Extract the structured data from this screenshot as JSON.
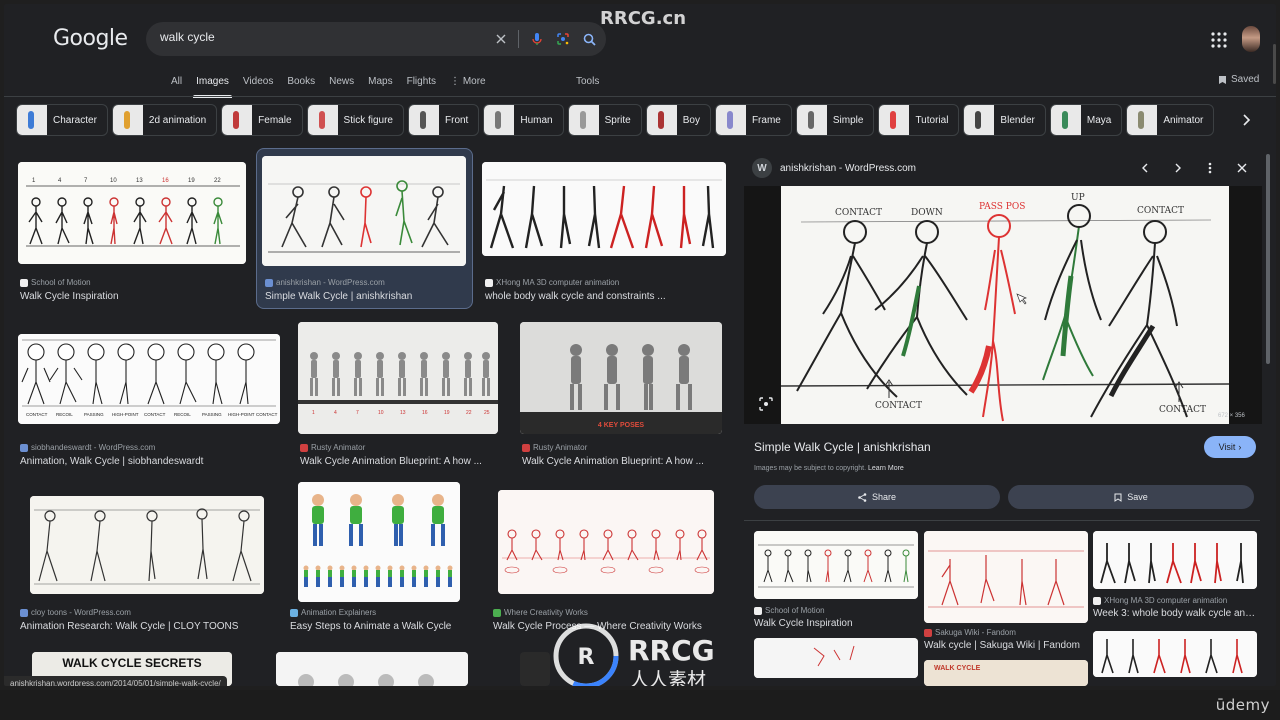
{
  "watermark": "RRCG.cn",
  "watermark_logo": {
    "line1": "RRCG",
    "line2": "人人素材"
  },
  "header": {
    "logo": "Google",
    "search_value": "walk cycle",
    "saved": "Saved"
  },
  "tabs": [
    {
      "label": "All",
      "active": false
    },
    {
      "label": "Images",
      "active": true
    },
    {
      "label": "Videos",
      "active": false
    },
    {
      "label": "Books",
      "active": false
    },
    {
      "label": "News",
      "active": false
    },
    {
      "label": "Maps",
      "active": false
    },
    {
      "label": "Flights",
      "active": false
    },
    {
      "label": "⋮ More",
      "active": false
    }
  ],
  "tools": "Tools",
  "chips": [
    {
      "label": "Character",
      "color": "#3d7bd6"
    },
    {
      "label": "2d animation",
      "color": "#e0a030"
    },
    {
      "label": "Female",
      "color": "#c03a3a"
    },
    {
      "label": "Stick figure",
      "color": "#d05050"
    },
    {
      "label": "Front",
      "color": "#555555"
    },
    {
      "label": "Human",
      "color": "#777777"
    },
    {
      "label": "Sprite",
      "color": "#999999"
    },
    {
      "label": "Boy",
      "color": "#aa3333"
    },
    {
      "label": "Frame",
      "color": "#8888cc"
    },
    {
      "label": "Simple",
      "color": "#666666"
    },
    {
      "label": "Tutorial",
      "color": "#e04040"
    },
    {
      "label": "Blender",
      "color": "#444444"
    },
    {
      "label": "Maya",
      "color": "#3a8a5a"
    },
    {
      "label": "Animator",
      "color": "#8a8a70"
    }
  ],
  "results": [
    {
      "source": "School of Motion",
      "title": "Walk Cycle Inspiration",
      "fav": "#f0f0f0"
    },
    {
      "source": "anishkrishan - WordPress.com",
      "title": "Simple Walk Cycle | anishkrishan",
      "fav": "#6b8fd1"
    },
    {
      "source": "XHong MA 3D computer animation",
      "title": "whole body walk cycle and constraints ...",
      "fav": "#f0f0f0"
    },
    {
      "source": "siobhandeswardt - WordPress.com",
      "title": "Animation, Walk Cycle | siobhandeswardt",
      "fav": "#6b8fd1"
    },
    {
      "source": "Rusty Animator",
      "title": "Walk Cycle Animation Blueprint: A how ...",
      "fav": "#d04040"
    },
    {
      "source": "Rusty Animator",
      "title": "Walk Cycle Animation Blueprint: A how ...",
      "fav": "#d04040"
    },
    {
      "source": "cloy toons - WordPress.com",
      "title": "Animation Research: Walk Cycle | CLOY TOONS",
      "fav": "#6b8fd1"
    },
    {
      "source": "Animation Explainers",
      "title": "Easy Steps to Animate a Walk Cycle",
      "fav": "#6bb0e0"
    },
    {
      "source": "Where Creativity Works",
      "title": "Walk Cycle Process — Where Creativity Works",
      "fav": "#4caf50"
    }
  ],
  "grid_image_text": {
    "poses_caption": "4 KEY POSES",
    "secrets_banner": "WALK CYCLE SECRETS",
    "recoil_labels": [
      "CONTACT",
      "RECOIL",
      "PASSING",
      "HIGH-POINT",
      "CONTACT",
      "RECOIL",
      "PASSING",
      "HIGH-POINT",
      "CONTACT"
    ],
    "frame_numbers": [
      "1",
      "4",
      "7",
      "10",
      "13",
      "16",
      "19",
      "22",
      "25"
    ]
  },
  "preview": {
    "source": "anishkrishan - WordPress.com",
    "title": "Simple Walk Cycle | anishkrishan",
    "dims": "672 × 356",
    "visit": "Visit",
    "copyright": "Images may be subject to copyright.",
    "learn_more": "Learn More",
    "share": "Share",
    "save": "Save",
    "labels": {
      "contact1": "CONTACT",
      "down": "DOWN",
      "pass": "PASS POS",
      "up": "UP",
      "contact2": "CONTACT",
      "bottom1": "CONTACT",
      "bottom2": "CONTACT"
    }
  },
  "related": [
    {
      "source": "School of Motion",
      "title": "Walk Cycle Inspiration"
    },
    {
      "source": "Sakuga Wiki - Fandom",
      "title": "Walk cycle | Sakuga Wiki | Fandom"
    },
    {
      "source": "XHong MA 3D computer animation",
      "title": "Week 3: whole body walk cycle and ..."
    }
  ],
  "related_image_text": {
    "walk_cycle_tag": "WALK CYCLE"
  },
  "status_url": "anishkrishan.wordpress.com/2014/05/01/simple-walk-cycle/",
  "udemy": "ūdemy"
}
